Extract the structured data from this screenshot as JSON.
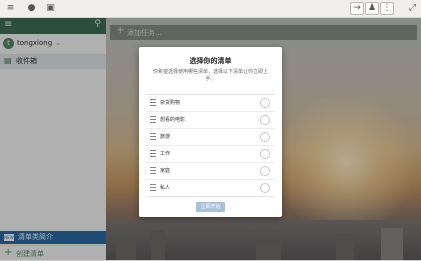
{
  "titlebar": {
    "left_icons": [
      "hamburger-icon",
      "bell-icon",
      "gift-icon"
    ],
    "right_icons": [
      "sign-out-icon",
      "user-icon",
      "more-icon",
      "fullscreen-icon"
    ]
  },
  "sidebar": {
    "user": {
      "initial": "t",
      "name": "tongxiong",
      "caret": "⌄"
    },
    "inbox": {
      "label": "收件箱"
    },
    "intro": {
      "label": "清单类简介",
      "icon_text": "NEW"
    },
    "new_list": {
      "label": "创建清单"
    }
  },
  "main": {
    "add_placeholder": "添加任务..."
  },
  "dialog": {
    "title": "选择你的清单",
    "subtitle": "你希望选择使用哪些清单，选择以下清单让你立即上手。",
    "items": [
      {
        "label": "杂货购物"
      },
      {
        "label": "想看的电影"
      },
      {
        "label": "旅游"
      },
      {
        "label": "工作"
      },
      {
        "label": "家庭"
      },
      {
        "label": "私人"
      }
    ],
    "start_label": "立即开始"
  },
  "colors": {
    "accent_green": "#3e6c54",
    "selected_blue": "#2c6aa6",
    "start_button": "#a8c2da"
  }
}
